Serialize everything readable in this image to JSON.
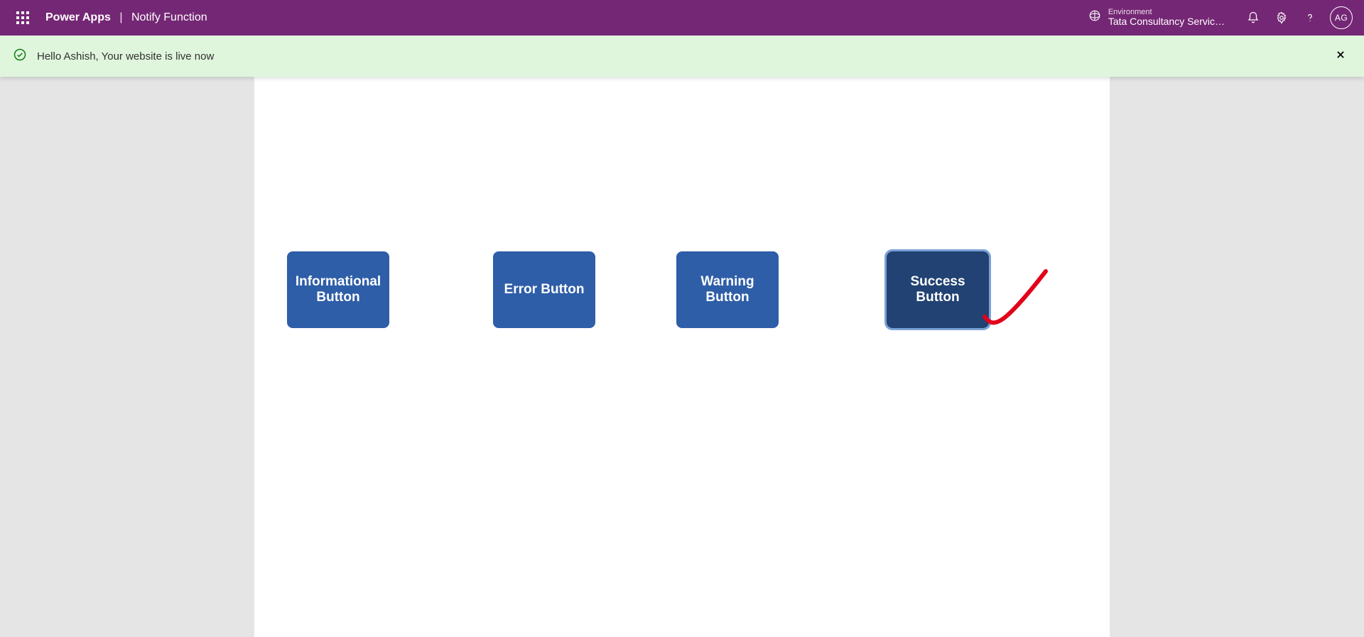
{
  "header": {
    "product": "Power Apps",
    "separator": "|",
    "page": "Notify Function",
    "environment_label": "Environment",
    "environment_name": "Tata Consultancy Servic…",
    "avatar_initials": "AG"
  },
  "notification": {
    "message": "Hello Ashish, Your website is live now"
  },
  "buttons": {
    "informational": "Informational Button",
    "error": "Error Button",
    "warning": "Warning Button",
    "success": "Success Button"
  }
}
